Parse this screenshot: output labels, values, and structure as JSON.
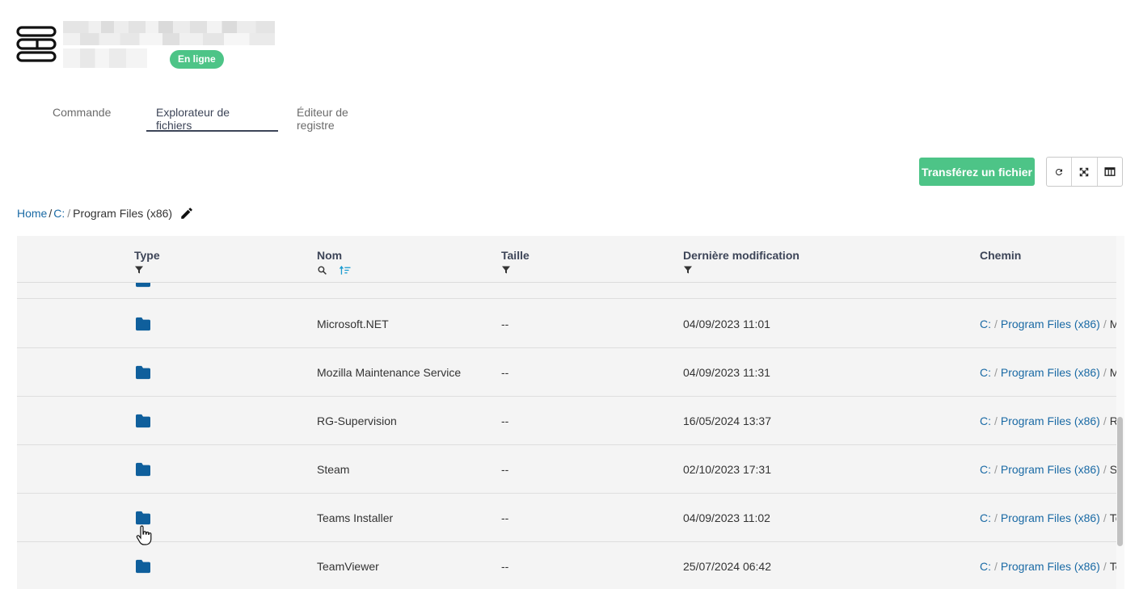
{
  "header": {
    "status": "En ligne"
  },
  "tabs": [
    {
      "label": "Commande",
      "active": false
    },
    {
      "label": "Explorateur de fichiers",
      "active": true
    },
    {
      "label": "Éditeur de registre",
      "active": false
    }
  ],
  "toolbar": {
    "upload_label": "Transférez un fichier",
    "icons": [
      "refresh-icon",
      "fit-screen-icon",
      "columns-icon"
    ]
  },
  "breadcrumb": {
    "home": "Home",
    "sep": "/",
    "drive": "C:",
    "current": "Program Files (x86)"
  },
  "table": {
    "columns": {
      "type": "Type",
      "name": "Nom",
      "size": "Taille",
      "modified": "Dernière modification",
      "path": "Chemin"
    },
    "rows": [
      {
        "name": "Microsoft.NET",
        "size": "--",
        "modified": "04/09/2023 11:01",
        "path_drive": "C:",
        "path_folder": "Program Files (x86)",
        "path_tail": "Mi"
      },
      {
        "name": "Mozilla Maintenance Service",
        "size": "--",
        "modified": "04/09/2023 11:31",
        "path_drive": "C:",
        "path_folder": "Program Files (x86)",
        "path_tail": "Mo"
      },
      {
        "name": "RG-Supervision",
        "size": "--",
        "modified": "16/05/2024 13:37",
        "path_drive": "C:",
        "path_folder": "Program Files (x86)",
        "path_tail": "RG"
      },
      {
        "name": "Steam",
        "size": "--",
        "modified": "02/10/2023 17:31",
        "path_drive": "C:",
        "path_folder": "Program Files (x86)",
        "path_tail": "St"
      },
      {
        "name": "Teams Installer",
        "size": "--",
        "modified": "04/09/2023 11:02",
        "path_drive": "C:",
        "path_folder": "Program Files (x86)",
        "path_tail": "Te"
      },
      {
        "name": "TeamViewer",
        "size": "--",
        "modified": "25/07/2024 06:42",
        "path_drive": "C:",
        "path_folder": "Program Files (x86)",
        "path_tail": "Te"
      }
    ]
  },
  "colors": {
    "accent_green": "#4dc487",
    "link_blue": "#1a6aa5",
    "folder_blue": "#0f5f9c",
    "header_text": "#3c4457"
  }
}
